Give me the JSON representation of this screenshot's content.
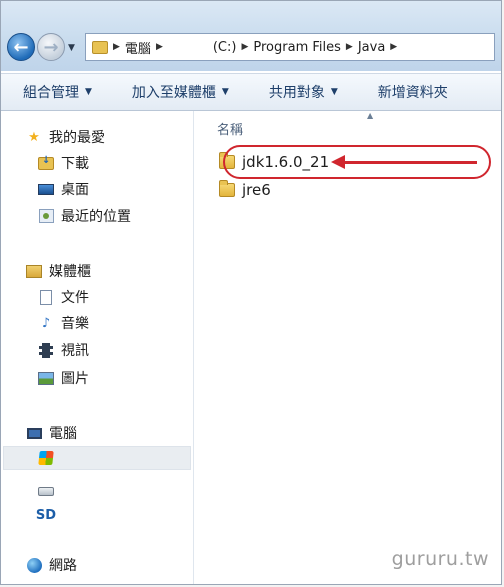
{
  "address_bar": {
    "crumbs": [
      "電腦",
      "(C:)",
      "Program Files",
      "Java"
    ]
  },
  "toolbar": {
    "organize_label": "組合管理",
    "include_label": "加入至媒體櫃",
    "share_label": "共用對象",
    "new_folder_label": "新增資料夾"
  },
  "nav": {
    "favorites": "我的最愛",
    "downloads": "下載",
    "desktop": "桌面",
    "recent": "最近的位置",
    "libraries": "媒體櫃",
    "documents": "文件",
    "music": "音樂",
    "videos": "視訊",
    "pictures": "圖片",
    "computer": "電腦",
    "network": "網路",
    "sd_label": "SD"
  },
  "content": {
    "column_name": "名稱",
    "files": [
      "jdk1.6.0_21",
      "jre6"
    ]
  },
  "watermark": "gururu.tw",
  "colors": {
    "highlight": "#d0262e",
    "toolbar_text": "#1e3f6a"
  }
}
